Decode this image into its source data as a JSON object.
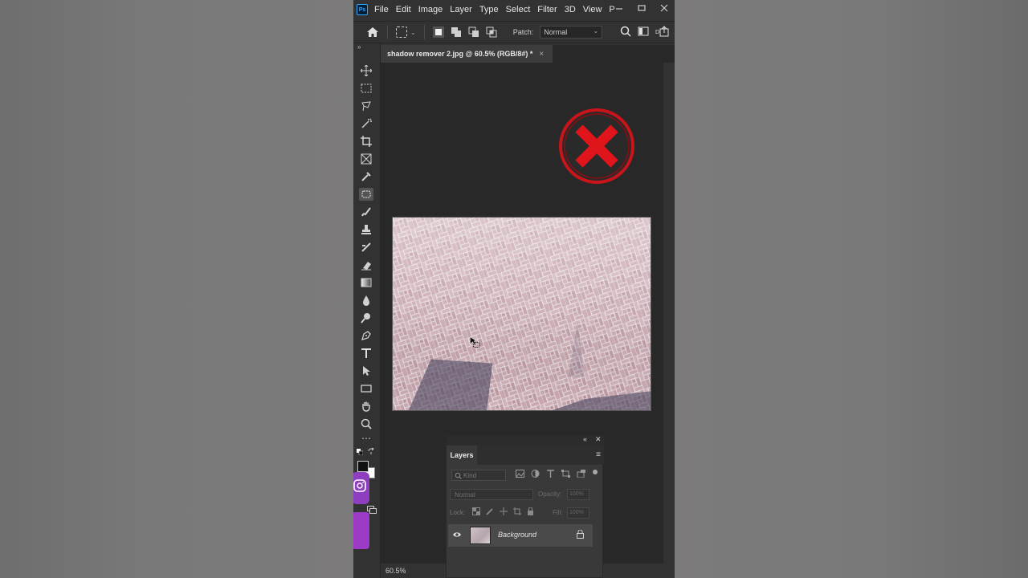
{
  "app": {
    "logo": "Ps",
    "menu": [
      "File",
      "Edit",
      "Image",
      "Layer",
      "Type",
      "Select",
      "Filter",
      "3D",
      "View",
      "P"
    ],
    "window_controls": [
      "minimize",
      "maximize",
      "close"
    ]
  },
  "options_bar": {
    "patch_label": "Patch:",
    "patch_mode": "Normal",
    "icons": [
      "home-icon",
      "patch-tool-icon",
      "search-icon",
      "workspace-icon",
      "share-icon"
    ]
  },
  "document": {
    "tab_title": "shadow remover 2.jpg @ 60.5% (RGB/8#) *",
    "tab_close": "×",
    "zoom_status": "60.5%"
  },
  "overlay": {
    "reject_color": "#e0151b"
  },
  "tools": [
    "move",
    "marquee",
    "lasso",
    "magic-wand",
    "crop",
    "frame",
    "eyedropper",
    "patch",
    "brush",
    "clone-stamp",
    "history-brush",
    "eraser",
    "gradient",
    "blur",
    "dodge",
    "pen",
    "type",
    "path-select",
    "rectangle",
    "hand",
    "zoom",
    "more"
  ],
  "layers_panel": {
    "tab": "Layers",
    "kind_placeholder": "Kind",
    "blend_mode": "Normal",
    "opacity_label": "Opacity:",
    "opacity_value": "100%",
    "lock_label": "Lock:",
    "fill_label": "Fill:",
    "fill_value": "100%",
    "layers": [
      {
        "name": "Background",
        "visible": true,
        "locked": true
      }
    ]
  }
}
